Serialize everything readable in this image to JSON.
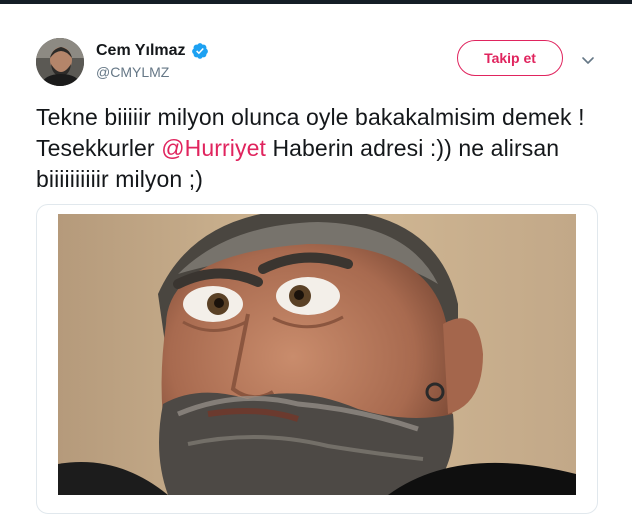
{
  "user": {
    "display_name": "Cem Yılmaz",
    "handle": "@CMYLMZ",
    "verified": true,
    "avatar_icon": "profile-photo"
  },
  "follow_button": {
    "label": "Takip et"
  },
  "menu_icon": "chevron-down-icon",
  "tweet": {
    "text_before": "Tekne biiiiir milyon olunca oyle bakakalmisim demek ! Tesekkurler ",
    "mention": "@Hurriyet",
    "text_after": " Haberin adresi :)) ne alirsan biiiiiiiiiir milyon ;)"
  },
  "media": {
    "image_icon": "photo-image"
  },
  "colors": {
    "accent": "#e0245e",
    "verified_blue": "#1da1f2",
    "text": "#14171a",
    "secondary_text": "#657786",
    "border": "#e1e8ed"
  }
}
